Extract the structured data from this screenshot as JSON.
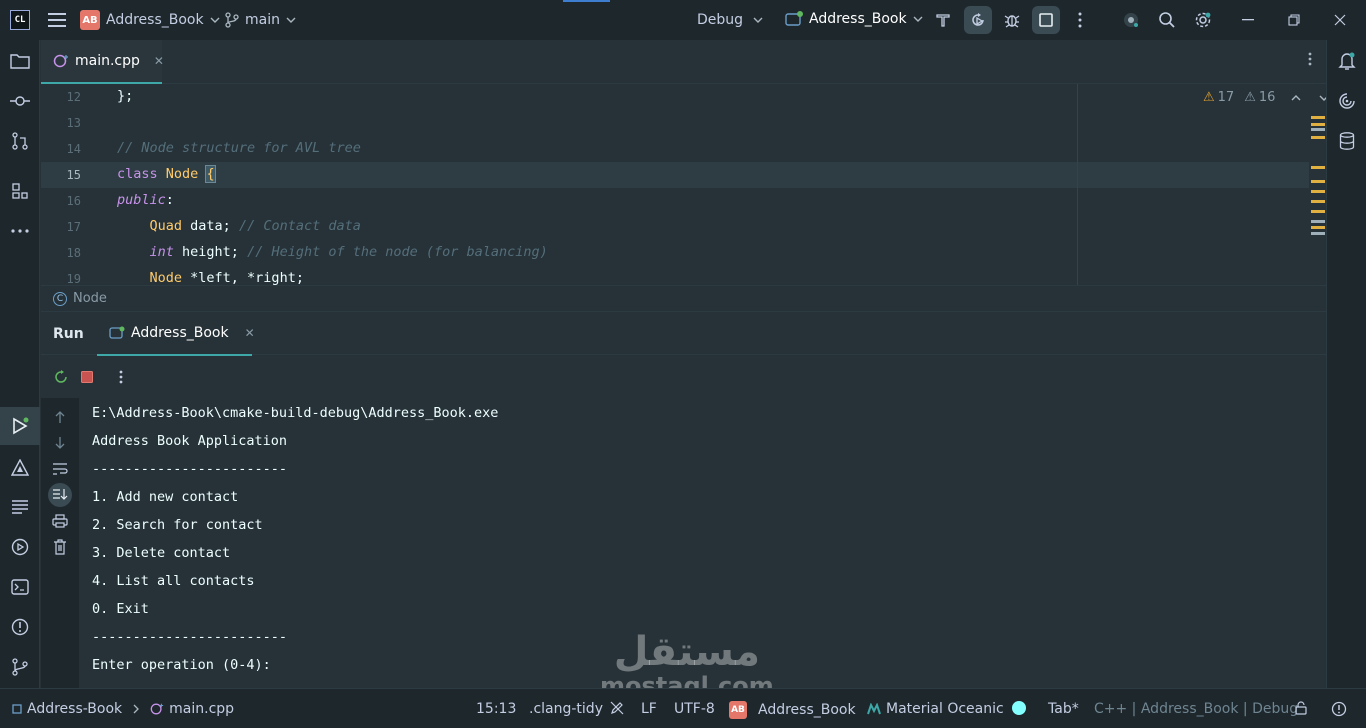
{
  "titlebar": {
    "app_logo": "CL",
    "project_badge": "AB",
    "project_name": "Address_Book",
    "branch": "main",
    "configuration": "Debug",
    "run_configuration": "Address_Book"
  },
  "editor": {
    "tab_label": "main.cpp",
    "inspection": {
      "warnings": "17",
      "weak_warnings": "16"
    },
    "lines": [
      {
        "num": "12",
        "text": "};"
      },
      {
        "num": "13",
        "text": ""
      },
      {
        "num": "14",
        "text": "// Node structure for AVL tree"
      },
      {
        "num": "15",
        "text": "class Node {"
      },
      {
        "num": "16",
        "text": "public:"
      },
      {
        "num": "17",
        "text": "    Quad data; // Contact data"
      },
      {
        "num": "18",
        "text": "    int height; // Height of the node (for balancing)"
      },
      {
        "num": "19",
        "text": "    Node *left, *right;"
      }
    ],
    "code_parts": {
      "l12": "};",
      "l14": "// Node structure for AVL tree",
      "l15_kw": "class",
      "l15_type": "Node",
      "l15_brace": "{",
      "l16": "public",
      "l16_colon": ":",
      "l17_type": "Quad",
      "l17_var": " data;",
      "l17_cmt": "// Contact data",
      "l18_kw": "int",
      "l18_var": " height;",
      "l18_cmt": "// Height of the node (for balancing)",
      "l19_type": "Node",
      "l19_rest": " *left, *right;"
    },
    "breadcrumb_symbol": "Node",
    "breadcrumb_badge": "C"
  },
  "run_panel": {
    "title": "Run",
    "tab_label": "Address_Book",
    "console_lines": [
      "E:\\Address-Book\\cmake-build-debug\\Address_Book.exe",
      "Address Book Application",
      "------------------------",
      "1. Add new contact",
      "2. Search for contact",
      "3. Delete contact",
      "4. List all contacts",
      "0. Exit",
      "------------------------",
      "Enter operation (0-4):"
    ]
  },
  "statusbar": {
    "project": "Address-Book",
    "file": "main.cpp",
    "position": "15:13",
    "clang_tidy": ".clang-tidy",
    "line_endings": "LF",
    "encoding": "UTF-8",
    "project_badge": "AB",
    "context": "Address_Book",
    "theme": "Material Oceanic",
    "indent": "Tab*",
    "language_context": "C++ | Address_Book | Debug"
  },
  "watermark": {
    "arabic": "مستقل",
    "latin": "mostaql.com"
  },
  "colors": {
    "background": "#263238",
    "accent": "#3ea8a8",
    "keyword": "#c792ea",
    "type": "#ffcb6b",
    "comment": "#546e7a",
    "warning": "#e0a030",
    "badge": "#e4766a"
  }
}
